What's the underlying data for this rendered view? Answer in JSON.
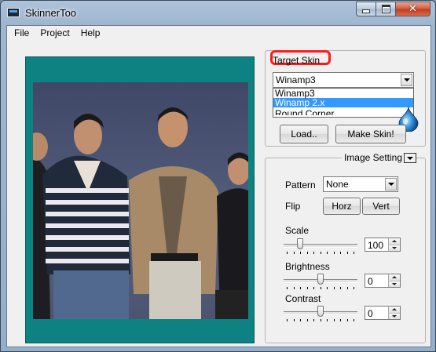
{
  "window": {
    "title": "SkinnerToo"
  },
  "menu": {
    "items": [
      "File",
      "Project",
      "Help"
    ]
  },
  "target_skin": {
    "label": "Target Skin",
    "selected": "Winamp3",
    "options": [
      "Winamp3",
      "Winamp 2.x",
      "Round Corner"
    ],
    "highlighted_option": "Winamp 2.x",
    "load_label": "Load..",
    "make_label": "Make Skin!"
  },
  "image_setting": {
    "label": "Image Setting",
    "pattern_label": "Pattern",
    "pattern_value": "None",
    "flip_label": "Flip",
    "horz_label": "Horz",
    "vert_label": "Vert",
    "scale_label": "Scale",
    "scale_value": "100",
    "scale_level": 0.2,
    "brightness_label": "Brightness",
    "brightness_value": "0",
    "brightness_level": 0.5,
    "contrast_label": "Contrast",
    "contrast_value": "0",
    "contrast_level": 0.5
  },
  "colors": {
    "panel_teal": "#0e8283",
    "selection_blue": "#3399ff",
    "highlight_red": "#ff1a1a"
  }
}
